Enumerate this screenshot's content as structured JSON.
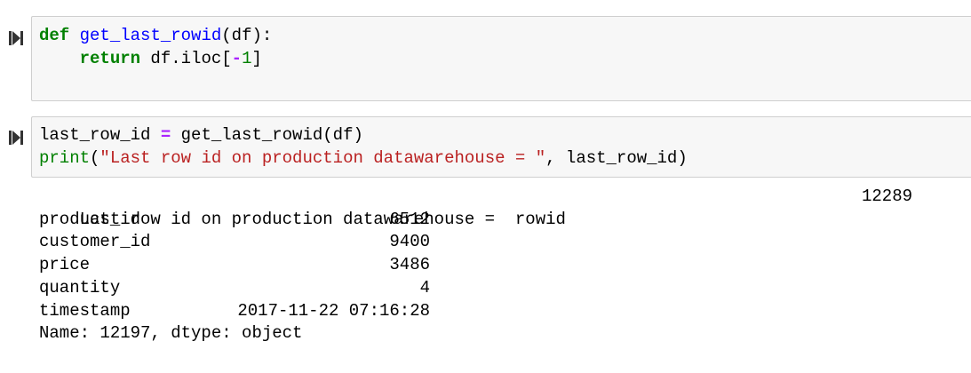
{
  "cell1": {
    "line1": {
      "kw_def": "def",
      "fn_name": "get_last_rowid",
      "params": "(df):"
    },
    "line2": {
      "indent": "    ",
      "kw_return": "return",
      "expr_a": " df.iloc[",
      "minus": "-",
      "num": "1",
      "expr_b": "]"
    }
  },
  "cell2": {
    "line1": {
      "var": "last_row_id ",
      "eq": "=",
      "call": " get_last_rowid(df)"
    },
    "line2": {
      "print": "print",
      "open": "(",
      "str": "\"Last row id on production datawarehouse = \"",
      "rest": ", last_row_id)"
    }
  },
  "output": {
    "line1_label": "Last row id on production datawarehouse =  rowid",
    "line1_value": "12289",
    "rows": [
      {
        "key": "product_id",
        "value": "6512"
      },
      {
        "key": "customer_id",
        "value": "9400"
      },
      {
        "key": "price",
        "value": "3486"
      },
      {
        "key": "quantity",
        "value": "4"
      },
      {
        "key": "timestamp",
        "value": "2017-11-22 07:16:28"
      }
    ],
    "footer": "Name: 12197, dtype: object"
  }
}
